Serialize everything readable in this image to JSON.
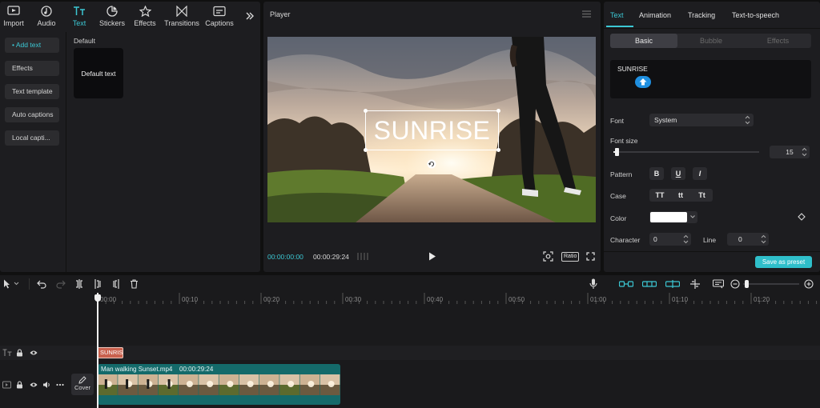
{
  "toolbar": {
    "tabs": [
      {
        "label": "Import",
        "icon": "import-icon"
      },
      {
        "label": "Audio",
        "icon": "audio-icon"
      },
      {
        "label": "Text",
        "icon": "text-icon"
      },
      {
        "label": "Stickers",
        "icon": "stickers-icon"
      },
      {
        "label": "Effects",
        "icon": "effects-icon"
      },
      {
        "label": "Transitions",
        "icon": "transitions-icon"
      },
      {
        "label": "Captions",
        "icon": "captions-icon"
      }
    ],
    "more_icon": "double-chevron-right-icon"
  },
  "sidebar": {
    "items": [
      {
        "label": "• Add text"
      },
      {
        "label": "Effects"
      },
      {
        "label": "Text template"
      },
      {
        "label": "Auto captions"
      },
      {
        "label": "Local capti..."
      }
    ]
  },
  "text_library": {
    "section_title": "Default",
    "card_label": "Default text"
  },
  "player": {
    "title": "Player",
    "overlay_text": "SUNRISE",
    "time_current": "00:00:00:00",
    "time_total": "00:00:29:24",
    "ratio_label": "Ratio"
  },
  "inspector": {
    "tabs": [
      "Text",
      "Animation",
      "Tracking",
      "Text-to-speech"
    ],
    "subtabs": [
      "Basic",
      "Bubble",
      "Effects"
    ],
    "text_value": "SUNRISE",
    "font_label": "Font",
    "font_value": "System",
    "font_size_label": "Font size",
    "font_size_value": "15",
    "font_size_fraction": 0.02,
    "pattern_label": "Pattern",
    "pattern_buttons": [
      "B",
      "U",
      "I"
    ],
    "case_label": "Case",
    "case_buttons": [
      "TT",
      "tt",
      "Tt"
    ],
    "color_label": "Color",
    "color_value": "#ffffff",
    "character_label": "Character",
    "character_value": "0",
    "line_label": "Line",
    "line_value": "0",
    "save_preset_label": "Save as preset",
    "accent": "#3cc8d4"
  },
  "timeline": {
    "ticks": [
      "00:00",
      "00:10",
      "00:20",
      "00:30",
      "00:40",
      "00:50",
      "01:00",
      "01:10",
      "01:20"
    ],
    "text_clip_label": "SUNRIS",
    "video_clip_name": "Man walking Sunset.mp4",
    "video_clip_duration": "00:00:29:24",
    "cover_label": "Cover"
  }
}
